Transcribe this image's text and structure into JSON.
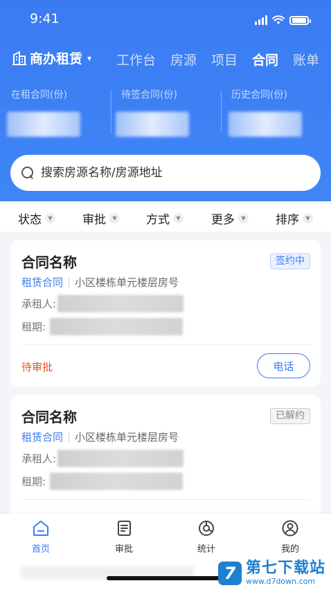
{
  "status_bar": {
    "time": "9:41"
  },
  "nav": {
    "brand": "商办租赁",
    "tabs": [
      {
        "label": "工作台"
      },
      {
        "label": "房源"
      },
      {
        "label": "项目"
      },
      {
        "label": "合同"
      },
      {
        "label": "账单"
      }
    ]
  },
  "stats": [
    {
      "label": "在租合同(份)"
    },
    {
      "label": "待签合同(份)"
    },
    {
      "label": "历史合同(份)"
    }
  ],
  "search": {
    "placeholder": "搜索房源名称/房源地址"
  },
  "filters": [
    "状态",
    "审批",
    "方式",
    "更多",
    "排序"
  ],
  "contracts": [
    {
      "title": "合同名称",
      "status": "签约中",
      "type": "租赁合同",
      "address": "小区楼栋单元楼层房号",
      "tenant_label": "承租人:",
      "period_label": "租期:",
      "approval": "待审批",
      "action": "电话"
    },
    {
      "title": "合同名称",
      "status": "已解约",
      "type": "租赁合同",
      "address": "小区楼栋单元楼层房号",
      "tenant_label": "承租人:",
      "period_label": "租期:"
    }
  ],
  "tabbar": [
    {
      "label": "首页",
      "icon": "home-icon",
      "active": true
    },
    {
      "label": "审批",
      "icon": "document-icon"
    },
    {
      "label": "统计",
      "icon": "stats-icon"
    },
    {
      "label": "我的",
      "icon": "user-icon"
    }
  ],
  "watermark": {
    "name": "第七下载站",
    "url": "www.d7down.com",
    "logo_letter": "7"
  },
  "colors": {
    "primary": "#3b7bf2",
    "warning": "#e5531b"
  }
}
